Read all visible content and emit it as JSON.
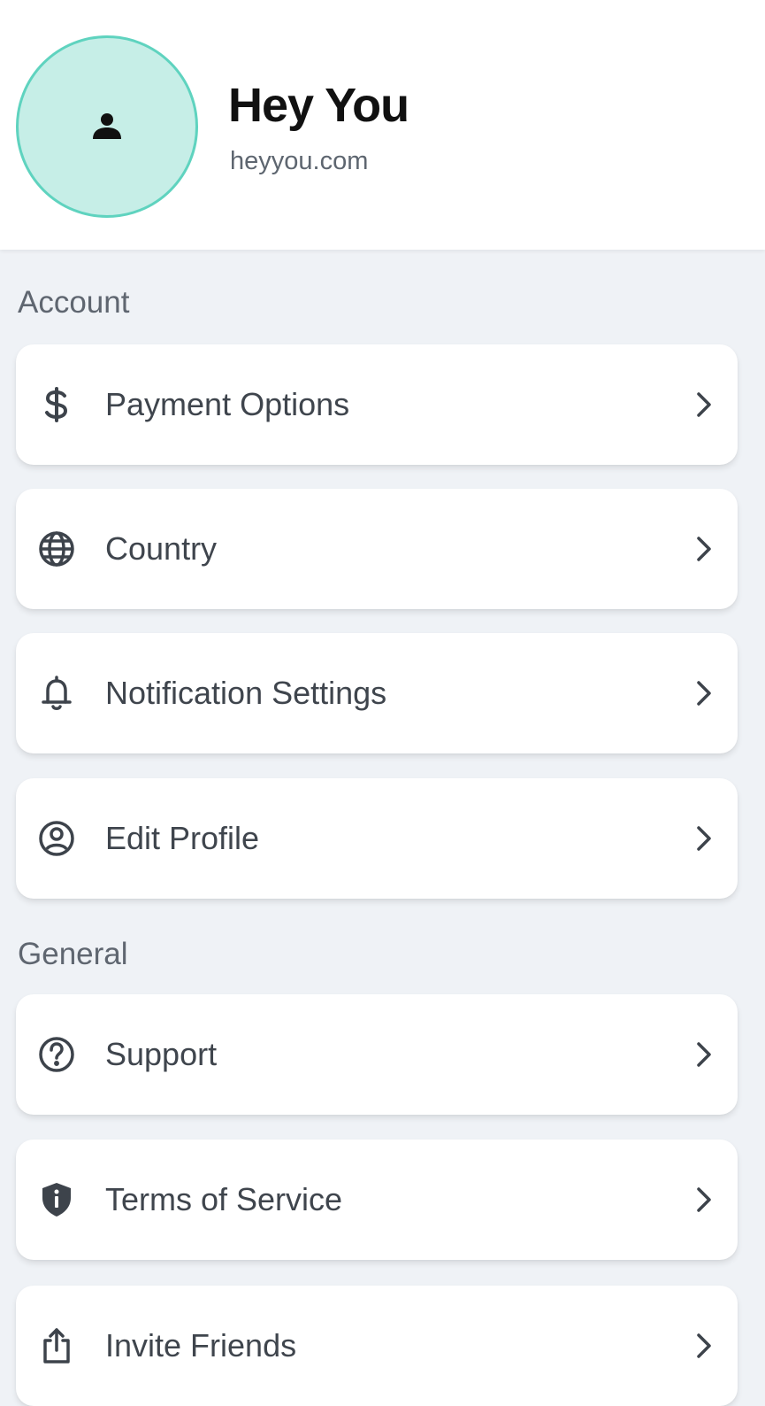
{
  "profile": {
    "name": "Hey You",
    "website": "heyyou.com",
    "avatar_icon": "person-icon",
    "avatar_bg": "#c6eee7",
    "avatar_border": "#5fd3bf"
  },
  "sections": {
    "account": {
      "title": "Account",
      "items": [
        {
          "label": "Payment Options",
          "icon": "dollar-icon"
        },
        {
          "label": "Country",
          "icon": "globe-icon"
        },
        {
          "label": "Notification Settings",
          "icon": "bell-icon"
        },
        {
          "label": "Edit Profile",
          "icon": "user-circle-icon"
        }
      ]
    },
    "general": {
      "title": "General",
      "items": [
        {
          "label": "Support",
          "icon": "help-circle-icon"
        },
        {
          "label": "Terms of Service",
          "icon": "shield-info-icon"
        },
        {
          "label": "Invite Friends",
          "icon": "share-icon"
        }
      ]
    }
  },
  "colors": {
    "background": "#eff2f6",
    "card": "#ffffff",
    "text": "#3f454d",
    "section_label": "#5f6670"
  }
}
